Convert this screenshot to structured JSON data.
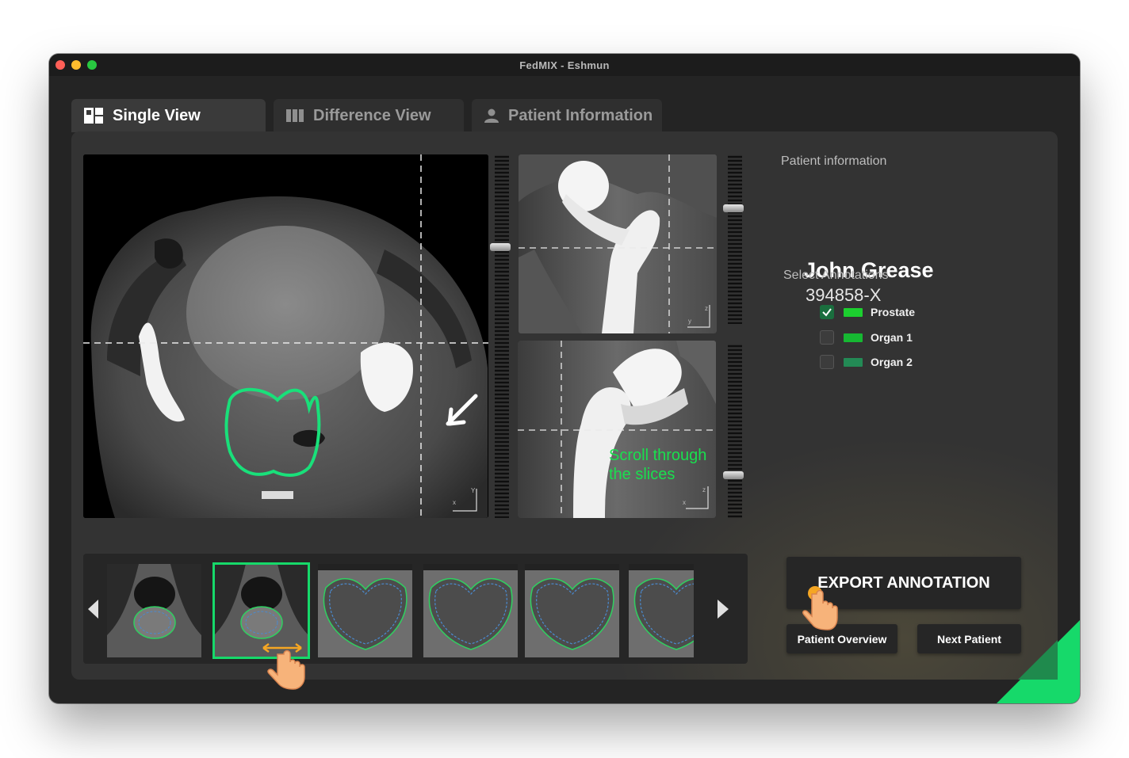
{
  "window": {
    "title": "FedMIX - Eshmun"
  },
  "tabs": [
    {
      "label": "Single View",
      "icon": "single-view-icon",
      "active": true
    },
    {
      "label": "Difference View",
      "icon": "columns-icon",
      "active": false
    },
    {
      "label": "Patient Information",
      "icon": "user-icon",
      "active": false
    }
  ],
  "viewer": {
    "overlay_line1": "Scroll through",
    "overlay_line2": "the slices",
    "axial_axes": {
      "x": "x",
      "y": "Y"
    },
    "coronal_axes": {
      "y": "y",
      "z": "z"
    },
    "sagittal_axes": {
      "x": "x",
      "z": "z"
    }
  },
  "patient": {
    "section_label": "Patient information",
    "name": "John Grease",
    "id": "394858-X"
  },
  "annotations": {
    "section_label": "Select Annotations",
    "items": [
      {
        "label": "Prostate",
        "checked": true,
        "color": "#1ccf2f"
      },
      {
        "label": "Organ 1",
        "checked": false,
        "color": "#16b832"
      },
      {
        "label": "Organ 2",
        "checked": false,
        "color": "#238a55"
      }
    ]
  },
  "actions": {
    "export_label": "EXPORT ANNOTATION",
    "overview_label": "Patient Overview",
    "next_label": "Next Patient"
  },
  "thumbnails": {
    "count": 6,
    "selected_index": 1
  },
  "colors": {
    "accent": "#16d96a",
    "contour": "#19e07a"
  }
}
